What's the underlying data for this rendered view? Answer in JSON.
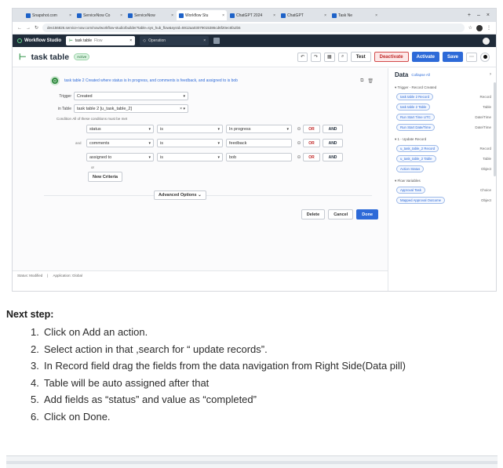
{
  "browser": {
    "tabs": [
      "Snapshot.com",
      "ServiceNow Co",
      "ServiceNow",
      "Workflow Stu",
      "ChatGPT 2024",
      "ChatGPT",
      "Task Ne"
    ],
    "url": "dev156826.service-now.com/now/workflow-studio/builder?table=sys_hub_flow&sysId=5912aa03079015386cd6f20ec6fa2b5"
  },
  "app": {
    "logo_label": "Workflow Studio",
    "tab_active": "task table",
    "tab_active_sub": "Flow",
    "tab_other": "Operation"
  },
  "toolbar": {
    "title": "task table",
    "status_badge": "Active",
    "test_label": "Test",
    "deactivate_label": "Deactivate",
    "activate_label": "Activate",
    "save_label": "Save"
  },
  "trigger": {
    "summary": "task table 2 Created where status is In progress, and comments is feedback, and assigned to is bob",
    "trigger_label": "Trigger",
    "trigger_value": "Created",
    "table_label": "in Table",
    "table_value": "task table 2 [u_task_table_2]",
    "condition_label": "Condition",
    "condition_hint": "All of these conditions must be met",
    "rows": [
      {
        "field": "status",
        "op": "is",
        "value": "In progress"
      },
      {
        "field": "comments",
        "op": "is",
        "value": "feedback"
      },
      {
        "field": "assigned to",
        "op": "is",
        "value": "bob"
      }
    ],
    "and_prefix": "and",
    "or_text": "or",
    "or_label": "OR",
    "and_label": "AND",
    "new_criteria": "New Criteria",
    "advanced_options": "Advanced Options",
    "delete_label": "Delete",
    "cancel_label": "Cancel",
    "done_label": "Done"
  },
  "statusbar": {
    "left": "Status: Modified",
    "right": "Application: Global"
  },
  "data_pane": {
    "title": "Data",
    "subtitle": "Collapse All",
    "sections": [
      {
        "name": "Trigger - Record Created",
        "pills": [
          {
            "label": "task table 2 Record",
            "type": "Record"
          },
          {
            "label": "task table 2 Table",
            "type": "Table"
          },
          {
            "label": "Run Start Time UTC",
            "type": "Date/Time"
          },
          {
            "label": "Run Start Date/Time",
            "type": "Date/Time"
          }
        ]
      },
      {
        "name": "1 - Update Record",
        "pills": [
          {
            "label": "u_task_table_2 Record",
            "type": "Record"
          },
          {
            "label": "u_task_table_2 Table",
            "type": "Table"
          },
          {
            "label": "Action Status",
            "type": "Object"
          }
        ]
      },
      {
        "name": "Flow Variables",
        "pills": [
          {
            "label": "Approval Task",
            "type": "Choice"
          },
          {
            "label": "Mapped Approval Outcome",
            "type": "Object"
          }
        ]
      }
    ]
  },
  "instructions": {
    "heading": "Next step:",
    "steps": [
      {
        "n": "1.",
        "text": "Click on Add an action."
      },
      {
        "n": "2.",
        "text": "Select action in that ,search for “ update records”."
      },
      {
        "n": "3.",
        "text": "In Record field drag the fields from the data navigation from Right Side(Data pill)"
      },
      {
        "n": "4.",
        "text": "Table will be auto assigned after that"
      },
      {
        "n": "5.",
        "text": "Add fields as “status” and value as “completed”"
      },
      {
        "n": "6.",
        "text": "Click on Done."
      }
    ]
  }
}
